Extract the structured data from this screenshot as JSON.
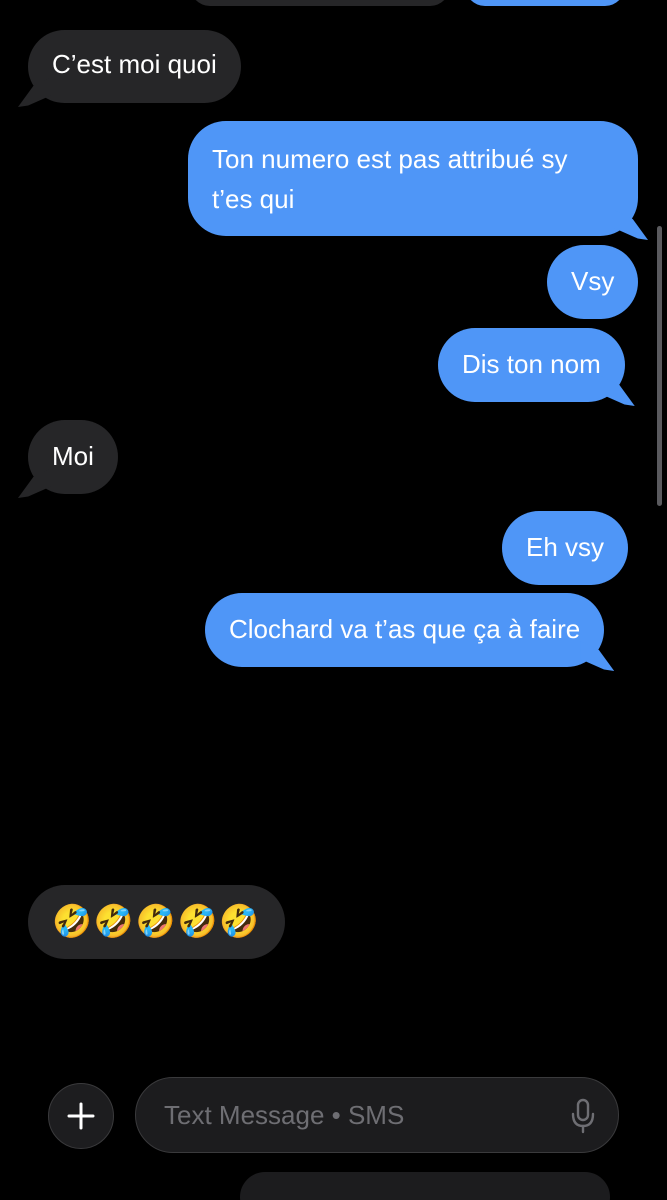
{
  "conversation": {
    "messages": [
      {
        "direction": "received",
        "type": "text",
        "text": "C’est moi quoi"
      },
      {
        "direction": "sent",
        "type": "text",
        "text": "Ton numero est pas attribué sy t’es qui"
      },
      {
        "direction": "sent",
        "type": "text",
        "text": "Vsy"
      },
      {
        "direction": "sent",
        "type": "text",
        "text": "Dis ton nom"
      },
      {
        "direction": "received",
        "type": "text",
        "text": "Moi"
      },
      {
        "direction": "sent",
        "type": "text",
        "text": "Eh vsy"
      },
      {
        "direction": "sent",
        "type": "text",
        "text": "Clochard va t’as que ça à faire"
      },
      {
        "direction": "received",
        "type": "emoji",
        "text": "😜"
      },
      {
        "direction": "received",
        "type": "text",
        "text": "🤣🤣🤣🤣🤣"
      },
      {
        "direction": "received",
        "type": "emoji",
        "text": "😘"
      }
    ]
  },
  "composer": {
    "add_icon": "plus-icon",
    "placeholder": "Text Message • SMS",
    "mic_icon": "microphone-icon"
  },
  "colors": {
    "sent_bubble": "#4f96f7",
    "received_bubble": "#262628",
    "background": "#000000"
  }
}
